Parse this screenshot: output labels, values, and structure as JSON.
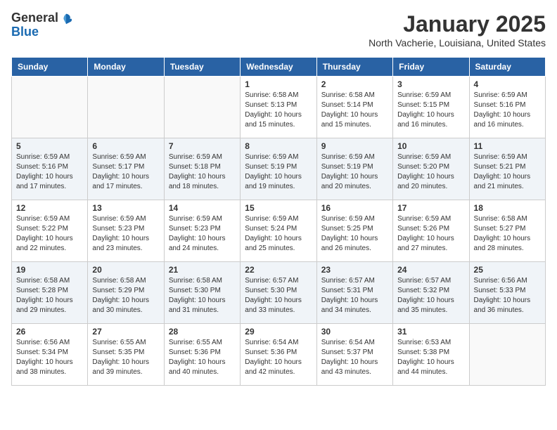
{
  "logo": {
    "general": "General",
    "blue": "Blue"
  },
  "header": {
    "month": "January 2025",
    "location": "North Vacherie, Louisiana, United States"
  },
  "weekdays": [
    "Sunday",
    "Monday",
    "Tuesday",
    "Wednesday",
    "Thursday",
    "Friday",
    "Saturday"
  ],
  "weeks": [
    [
      {
        "day": "",
        "info": ""
      },
      {
        "day": "",
        "info": ""
      },
      {
        "day": "",
        "info": ""
      },
      {
        "day": "1",
        "sunrise": "6:58 AM",
        "sunset": "5:13 PM",
        "daylight": "10 hours and 15 minutes."
      },
      {
        "day": "2",
        "sunrise": "6:58 AM",
        "sunset": "5:14 PM",
        "daylight": "10 hours and 15 minutes."
      },
      {
        "day": "3",
        "sunrise": "6:59 AM",
        "sunset": "5:15 PM",
        "daylight": "10 hours and 16 minutes."
      },
      {
        "day": "4",
        "sunrise": "6:59 AM",
        "sunset": "5:16 PM",
        "daylight": "10 hours and 16 minutes."
      }
    ],
    [
      {
        "day": "5",
        "sunrise": "6:59 AM",
        "sunset": "5:16 PM",
        "daylight": "10 hours and 17 minutes."
      },
      {
        "day": "6",
        "sunrise": "6:59 AM",
        "sunset": "5:17 PM",
        "daylight": "10 hours and 17 minutes."
      },
      {
        "day": "7",
        "sunrise": "6:59 AM",
        "sunset": "5:18 PM",
        "daylight": "10 hours and 18 minutes."
      },
      {
        "day": "8",
        "sunrise": "6:59 AM",
        "sunset": "5:19 PM",
        "daylight": "10 hours and 19 minutes."
      },
      {
        "day": "9",
        "sunrise": "6:59 AM",
        "sunset": "5:19 PM",
        "daylight": "10 hours and 20 minutes."
      },
      {
        "day": "10",
        "sunrise": "6:59 AM",
        "sunset": "5:20 PM",
        "daylight": "10 hours and 20 minutes."
      },
      {
        "day": "11",
        "sunrise": "6:59 AM",
        "sunset": "5:21 PM",
        "daylight": "10 hours and 21 minutes."
      }
    ],
    [
      {
        "day": "12",
        "sunrise": "6:59 AM",
        "sunset": "5:22 PM",
        "daylight": "10 hours and 22 minutes."
      },
      {
        "day": "13",
        "sunrise": "6:59 AM",
        "sunset": "5:23 PM",
        "daylight": "10 hours and 23 minutes."
      },
      {
        "day": "14",
        "sunrise": "6:59 AM",
        "sunset": "5:23 PM",
        "daylight": "10 hours and 24 minutes."
      },
      {
        "day": "15",
        "sunrise": "6:59 AM",
        "sunset": "5:24 PM",
        "daylight": "10 hours and 25 minutes."
      },
      {
        "day": "16",
        "sunrise": "6:59 AM",
        "sunset": "5:25 PM",
        "daylight": "10 hours and 26 minutes."
      },
      {
        "day": "17",
        "sunrise": "6:59 AM",
        "sunset": "5:26 PM",
        "daylight": "10 hours and 27 minutes."
      },
      {
        "day": "18",
        "sunrise": "6:58 AM",
        "sunset": "5:27 PM",
        "daylight": "10 hours and 28 minutes."
      }
    ],
    [
      {
        "day": "19",
        "sunrise": "6:58 AM",
        "sunset": "5:28 PM",
        "daylight": "10 hours and 29 minutes."
      },
      {
        "day": "20",
        "sunrise": "6:58 AM",
        "sunset": "5:29 PM",
        "daylight": "10 hours and 30 minutes."
      },
      {
        "day": "21",
        "sunrise": "6:58 AM",
        "sunset": "5:30 PM",
        "daylight": "10 hours and 31 minutes."
      },
      {
        "day": "22",
        "sunrise": "6:57 AM",
        "sunset": "5:30 PM",
        "daylight": "10 hours and 33 minutes."
      },
      {
        "day": "23",
        "sunrise": "6:57 AM",
        "sunset": "5:31 PM",
        "daylight": "10 hours and 34 minutes."
      },
      {
        "day": "24",
        "sunrise": "6:57 AM",
        "sunset": "5:32 PM",
        "daylight": "10 hours and 35 minutes."
      },
      {
        "day": "25",
        "sunrise": "6:56 AM",
        "sunset": "5:33 PM",
        "daylight": "10 hours and 36 minutes."
      }
    ],
    [
      {
        "day": "26",
        "sunrise": "6:56 AM",
        "sunset": "5:34 PM",
        "daylight": "10 hours and 38 minutes."
      },
      {
        "day": "27",
        "sunrise": "6:55 AM",
        "sunset": "5:35 PM",
        "daylight": "10 hours and 39 minutes."
      },
      {
        "day": "28",
        "sunrise": "6:55 AM",
        "sunset": "5:36 PM",
        "daylight": "10 hours and 40 minutes."
      },
      {
        "day": "29",
        "sunrise": "6:54 AM",
        "sunset": "5:36 PM",
        "daylight": "10 hours and 42 minutes."
      },
      {
        "day": "30",
        "sunrise": "6:54 AM",
        "sunset": "5:37 PM",
        "daylight": "10 hours and 43 minutes."
      },
      {
        "day": "31",
        "sunrise": "6:53 AM",
        "sunset": "5:38 PM",
        "daylight": "10 hours and 44 minutes."
      },
      {
        "day": "",
        "info": ""
      }
    ]
  ]
}
